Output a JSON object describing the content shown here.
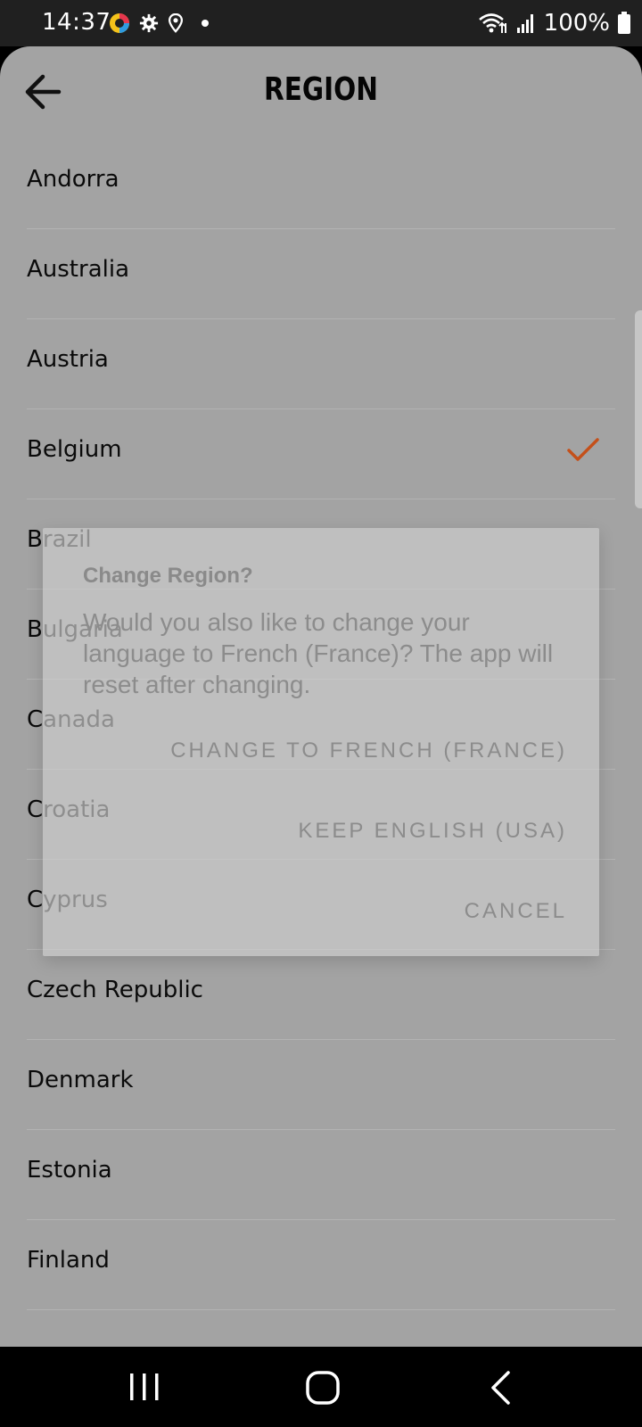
{
  "status_bar": {
    "time": "14:37",
    "battery": "100%",
    "icons": [
      "app-icon",
      "settings-icon",
      "location-icon",
      "dot-icon",
      "wifi-icon",
      "signal-icon",
      "battery-icon"
    ]
  },
  "header": {
    "title": "REGION",
    "back_icon": "arrow-left-icon"
  },
  "regions": [
    {
      "name": "Andorra"
    },
    {
      "name": "Australia"
    },
    {
      "name": "Austria"
    },
    {
      "name": "Belgium",
      "selected": true
    },
    {
      "name": "Brazil"
    },
    {
      "name": "Bulgaria"
    },
    {
      "name": "Canada"
    },
    {
      "name": "Croatia"
    },
    {
      "name": "Cyprus"
    },
    {
      "name": "Czech Republic"
    },
    {
      "name": "Denmark"
    },
    {
      "name": "Estonia"
    },
    {
      "name": "Finland"
    }
  ],
  "dialog": {
    "title": "Change Region?",
    "message": "Would you also like to change your language to French (France)? The app will reset after changing.",
    "change_button": "CHANGE TO FRENCH (FRANCE)",
    "keep_button": "KEEP ENGLISH (USA)",
    "cancel_button": "CANCEL"
  },
  "colors": {
    "accent": "#c4501a",
    "background": "#a3a3a3",
    "status_bar": "#202020"
  },
  "nav_bar": {
    "icons": [
      "recent-apps-icon",
      "home-icon",
      "back-icon"
    ]
  }
}
